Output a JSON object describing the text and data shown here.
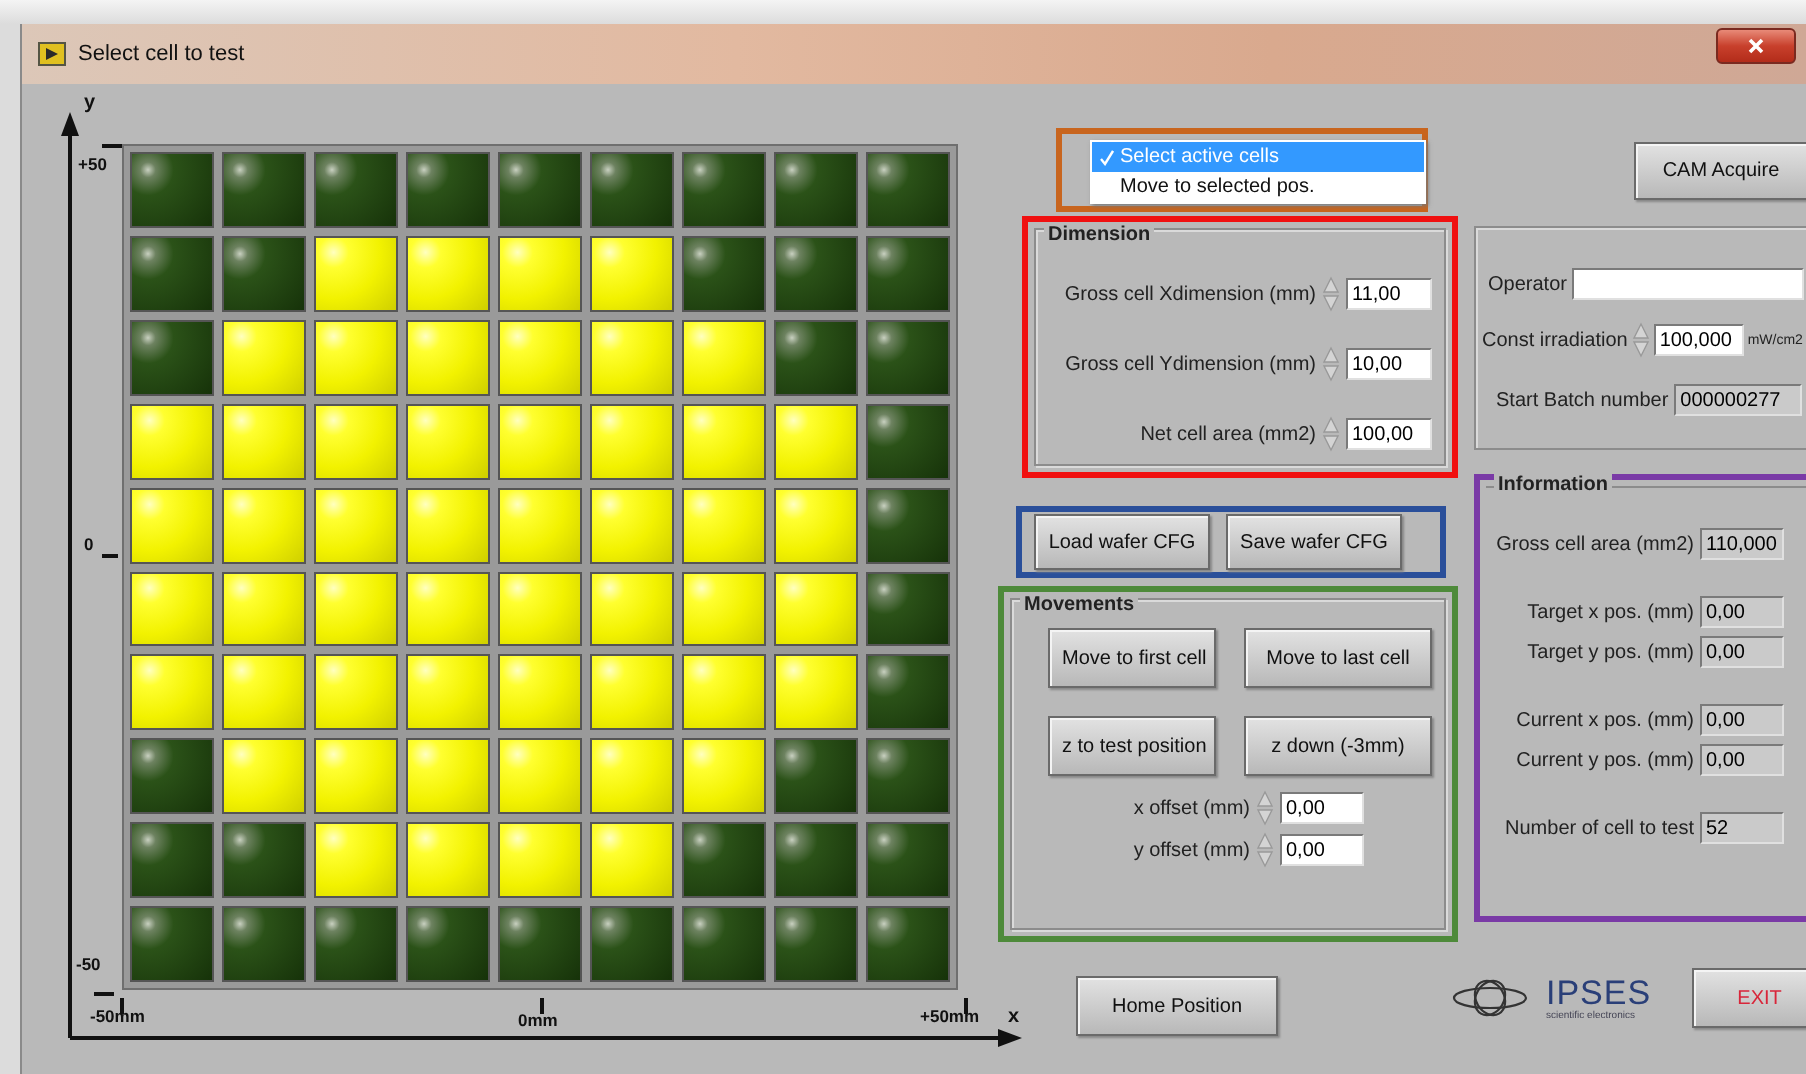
{
  "window": {
    "title": "Select cell to test"
  },
  "wafer_map": {
    "y_label": "y",
    "x_label": "x",
    "y_ticks": [
      "+50",
      "0",
      "-50"
    ],
    "x_ticks": [
      "-50mm",
      "0mm",
      "+50mm"
    ],
    "rows": [
      {
        "cells": [
          {
            "selected": false
          },
          {
            "selected": false
          },
          {
            "selected": false
          },
          {
            "selected": false
          },
          {
            "selected": false
          },
          {
            "selected": false
          },
          {
            "selected": false
          },
          {
            "selected": false
          },
          {
            "selected": false
          }
        ]
      },
      {
        "cells": [
          {
            "selected": false
          },
          {
            "selected": false
          },
          {
            "selected": true
          },
          {
            "selected": true
          },
          {
            "selected": true
          },
          {
            "selected": true
          },
          {
            "selected": false
          },
          {
            "selected": false
          },
          {
            "selected": false
          }
        ]
      },
      {
        "cells": [
          {
            "selected": false
          },
          {
            "selected": true
          },
          {
            "selected": true
          },
          {
            "selected": true
          },
          {
            "selected": true
          },
          {
            "selected": true
          },
          {
            "selected": true
          },
          {
            "selected": false
          },
          {
            "selected": false
          }
        ]
      },
      {
        "cells": [
          {
            "selected": true
          },
          {
            "selected": true
          },
          {
            "selected": true
          },
          {
            "selected": true
          },
          {
            "selected": true
          },
          {
            "selected": true
          },
          {
            "selected": true
          },
          {
            "selected": true
          },
          {
            "selected": false
          }
        ]
      },
      {
        "cells": [
          {
            "selected": true
          },
          {
            "selected": true
          },
          {
            "selected": true
          },
          {
            "selected": true
          },
          {
            "selected": true
          },
          {
            "selected": true
          },
          {
            "selected": true
          },
          {
            "selected": true
          },
          {
            "selected": false
          }
        ]
      },
      {
        "cells": [
          {
            "selected": true
          },
          {
            "selected": true
          },
          {
            "selected": true
          },
          {
            "selected": true
          },
          {
            "selected": true
          },
          {
            "selected": true
          },
          {
            "selected": true
          },
          {
            "selected": true
          },
          {
            "selected": false
          }
        ]
      },
      {
        "cells": [
          {
            "selected": true
          },
          {
            "selected": true
          },
          {
            "selected": true
          },
          {
            "selected": true
          },
          {
            "selected": true
          },
          {
            "selected": true
          },
          {
            "selected": true
          },
          {
            "selected": true
          },
          {
            "selected": false
          }
        ]
      },
      {
        "cells": [
          {
            "selected": false
          },
          {
            "selected": true
          },
          {
            "selected": true
          },
          {
            "selected": true
          },
          {
            "selected": true
          },
          {
            "selected": true
          },
          {
            "selected": true
          },
          {
            "selected": false
          },
          {
            "selected": false
          }
        ]
      },
      {
        "cells": [
          {
            "selected": false
          },
          {
            "selected": false
          },
          {
            "selected": true
          },
          {
            "selected": true
          },
          {
            "selected": true
          },
          {
            "selected": true
          },
          {
            "selected": false
          },
          {
            "selected": false
          },
          {
            "selected": false
          }
        ]
      },
      {
        "cells": [
          {
            "selected": false
          },
          {
            "selected": false
          },
          {
            "selected": false
          },
          {
            "selected": false
          },
          {
            "selected": false
          },
          {
            "selected": false
          },
          {
            "selected": false
          },
          {
            "selected": false
          },
          {
            "selected": false
          }
        ]
      }
    ]
  },
  "mode_menu": {
    "items": [
      {
        "label": "Select active cells",
        "selected": true
      },
      {
        "label": "Move to selected pos.",
        "selected": false
      }
    ]
  },
  "cam_button": "CAM Acquire",
  "dimension": {
    "title": "Dimension",
    "fields": [
      {
        "label": "Gross cell Xdimension (mm)",
        "value": "11,00"
      },
      {
        "label": "Gross cell Ydimension (mm)",
        "value": "10,00"
      },
      {
        "label": "Net cell area (mm2)",
        "value": "100,00"
      }
    ]
  },
  "operator_panel": {
    "operator": {
      "label": "Operator"
    },
    "irradiation": {
      "label": "Const irradiation",
      "value": "100,000",
      "unit": "mW/cm2"
    },
    "batch": {
      "label": "Start Batch number",
      "value": "000000277"
    }
  },
  "config_buttons": [
    "Load wafer CFG",
    "Save wafer CFG"
  ],
  "movements": {
    "title": "Movements",
    "buttons": [
      "Move to first cell",
      "Move to last cell",
      "z to test position",
      "z down (-3mm)"
    ],
    "offsets": [
      {
        "label": "x offset (mm)",
        "value": "0,00"
      },
      {
        "label": "y offset (mm)",
        "value": "0,00"
      }
    ]
  },
  "information": {
    "title": "Information",
    "groups": [
      {
        "fields": [
          {
            "label": "Gross cell area (mm2)",
            "value": "110,000"
          }
        ]
      },
      {
        "fields": [
          {
            "label": "Target x pos. (mm)",
            "value": "0,00"
          },
          {
            "label": "Target y pos. (mm)",
            "value": "0,00"
          }
        ]
      },
      {
        "fields": [
          {
            "label": "Current x pos. (mm)",
            "value": "0,00"
          },
          {
            "label": "Current y pos. (mm)",
            "value": "0,00"
          }
        ]
      },
      {
        "fields": [
          {
            "label": "Number of cell to test",
            "value": "52"
          }
        ]
      }
    ]
  },
  "home_button": "Home Position",
  "logo": {
    "name": "IPSES",
    "tagline": "scientific electronics"
  },
  "exit_button": "EXIT"
}
